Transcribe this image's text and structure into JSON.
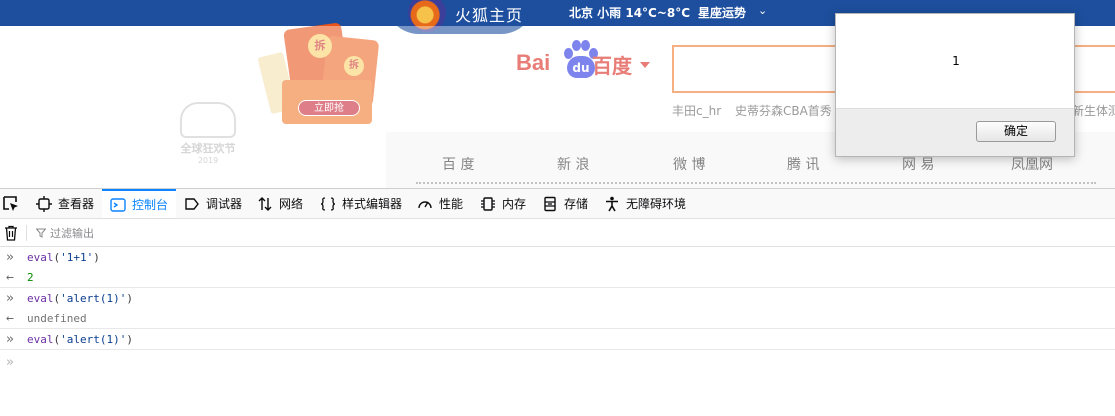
{
  "browser_page": {
    "site_title": "火狐主页",
    "weather": "北京  小雨 14°C~8°C",
    "horoscope": "星座运势",
    "promo": {
      "badge_top": "拆",
      "badge_bottom": "拆",
      "button": "立即抢"
    },
    "festival": {
      "name": "全球狂欢节",
      "year": "2019"
    },
    "search_logo": {
      "brand_latin": "Bai",
      "brand_du": "du",
      "brand_cn": "百度"
    },
    "hot_searches": [
      "丰田c_hr",
      "史蒂芬森CBA首秀"
    ],
    "hot_right": "新生体测",
    "sites": [
      "百 度",
      "新 浪",
      "微 博",
      "腾 讯",
      "网 易",
      "凤凰网"
    ]
  },
  "alert_dialog": {
    "message": "1",
    "ok_label": "确定"
  },
  "devtools": {
    "tabs": [
      {
        "label": "查看器",
        "icon": "inspector-icon",
        "active": false
      },
      {
        "label": "控制台",
        "icon": "console-icon",
        "active": true
      },
      {
        "label": "调试器",
        "icon": "debugger-icon",
        "active": false
      },
      {
        "label": "网络",
        "icon": "network-icon",
        "active": false
      },
      {
        "label": "样式编辑器",
        "icon": "style-editor-icon",
        "active": false
      },
      {
        "label": "性能",
        "icon": "performance-icon",
        "active": false
      },
      {
        "label": "内存",
        "icon": "memory-icon",
        "active": false
      },
      {
        "label": "存储",
        "icon": "storage-icon",
        "active": false
      },
      {
        "label": "无障碍环境",
        "icon": "accessibility-icon",
        "active": false
      }
    ],
    "filter_placeholder": "过滤输出",
    "console": {
      "entries": [
        {
          "type": "input",
          "fn": "eval",
          "arg": "'1+1'"
        },
        {
          "type": "result",
          "value": "2",
          "kind": "number"
        },
        {
          "type": "input",
          "fn": "eval",
          "arg": "'alert(1)'"
        },
        {
          "type": "result",
          "value": "undefined",
          "kind": "undefined"
        },
        {
          "type": "input",
          "fn": "eval",
          "arg": "'alert(1)'"
        }
      ],
      "prompt_value": ""
    },
    "colors": {
      "accent": "#0a84ff",
      "function": "#6b2fa6",
      "string": "#0a3d8f",
      "number": "#058b00"
    }
  }
}
